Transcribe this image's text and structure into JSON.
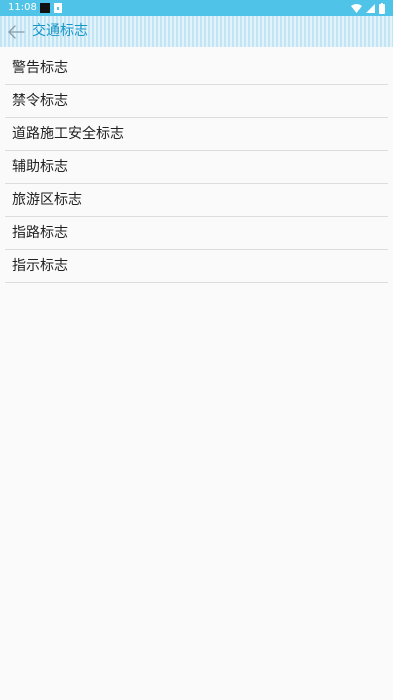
{
  "status_bar": {
    "time": "11:08",
    "background_color": "#4fc3e8",
    "icons": [
      "notification-square-icon",
      "download-notification-icon",
      "wifi-icon",
      "cell-signal-icon",
      "battery-icon"
    ]
  },
  "toolbar": {
    "title": "交通标志",
    "back_icon": "arrow-left-icon",
    "title_color": "#1596c9"
  },
  "list": {
    "items": [
      {
        "label": "警告标志"
      },
      {
        "label": "禁令标志"
      },
      {
        "label": "道路施工安全标志"
      },
      {
        "label": "辅助标志"
      },
      {
        "label": "旅游区标志"
      },
      {
        "label": "指路标志"
      },
      {
        "label": "指示标志"
      }
    ]
  }
}
